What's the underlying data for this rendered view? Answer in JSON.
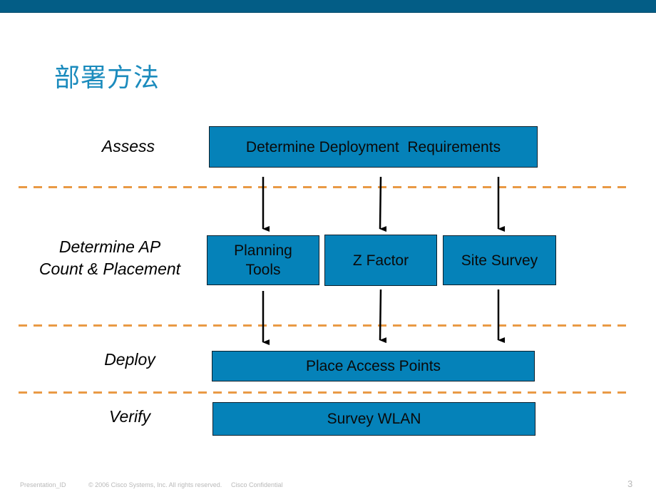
{
  "slide": {
    "title": "部署方法",
    "page_number": "3"
  },
  "stages": [
    {
      "label": "Assess"
    },
    {
      "label_line1": "Determine AP",
      "label_line2": "Count & Placement"
    },
    {
      "label": "Deploy"
    },
    {
      "label": "Verify"
    }
  ],
  "boxes": {
    "requirements": "Determine Deployment  Requirements",
    "planning_line1": "Planning",
    "planning_line2": "Tools",
    "zfactor": "Z Factor",
    "site_survey": "Site Survey",
    "place_aps": "Place Access Points",
    "survey_wlan": "Survey WLAN"
  },
  "footer": {
    "presentation_id": "Presentation_ID",
    "copyright": "© 2006 Cisco Systems, Inc. All rights reserved.",
    "confidential": "Cisco Confidential"
  },
  "colors": {
    "header_bar": "#035d86",
    "title": "#1b8bbd",
    "box_fill": "#0582b9",
    "dash_line": "#e99a45"
  }
}
